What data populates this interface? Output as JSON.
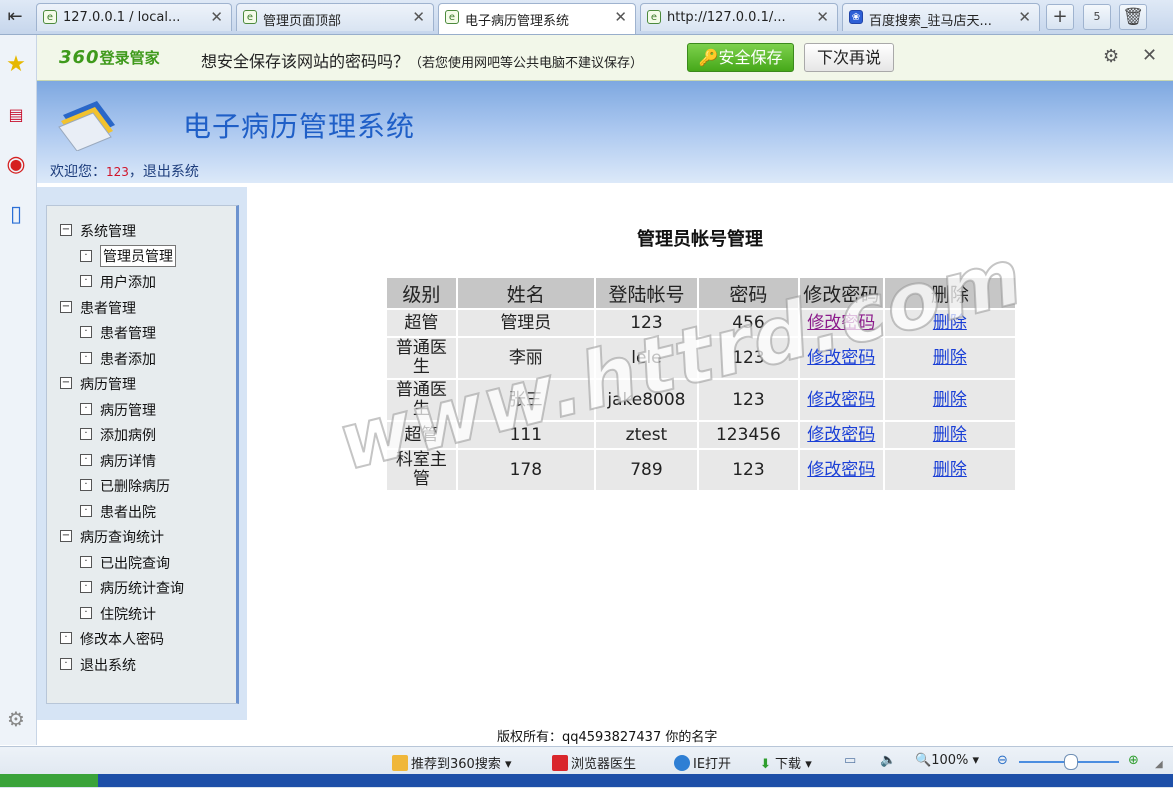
{
  "browser": {
    "tabs": [
      {
        "label": "127.0.0.1 / local...",
        "icon": "page-icon"
      },
      {
        "label": "管理页面顶部",
        "icon": "page-icon"
      },
      {
        "label": "电子病历管理系统",
        "icon": "page-icon",
        "active": true
      },
      {
        "label": "http://127.0.0.1/...",
        "icon": "page-icon"
      },
      {
        "label": "百度搜索_驻马店天...",
        "icon": "baidu-paw-icon"
      }
    ],
    "tab_count": "5"
  },
  "password_bar": {
    "brand_prefix": "360",
    "brand_suffix": "登录管家",
    "question": "想安全保存该网站的密码吗？",
    "note": "（若您使用网吧等公共电脑不建议保存）",
    "save_label": "安全保存",
    "later_label": "下次再说"
  },
  "header": {
    "title": "电子病历管理系统",
    "welcome_prefix": "欢迎您：",
    "user_id": "123",
    "logout_label": "，退出系统"
  },
  "sidebar": {
    "items": [
      {
        "label": "系统管理",
        "level": 0,
        "expanded": true
      },
      {
        "label": "管理员管理",
        "level": 1,
        "selected": true
      },
      {
        "label": "用户添加",
        "level": 1
      },
      {
        "label": "患者管理",
        "level": 0,
        "expanded": true
      },
      {
        "label": "患者管理",
        "level": 1
      },
      {
        "label": "患者添加",
        "level": 1
      },
      {
        "label": "病历管理",
        "level": 0,
        "expanded": true
      },
      {
        "label": "病历管理",
        "level": 1
      },
      {
        "label": "添加病例",
        "level": 1
      },
      {
        "label": "病历详情",
        "level": 1
      },
      {
        "label": "已删除病历",
        "level": 1
      },
      {
        "label": "患者出院",
        "level": 1
      },
      {
        "label": "病历查询统计",
        "level": 0,
        "expanded": true
      },
      {
        "label": "已出院查询",
        "level": 1
      },
      {
        "label": "病历统计查询",
        "level": 1
      },
      {
        "label": "住院统计",
        "level": 1
      },
      {
        "label": "修改本人密码",
        "level": 0
      },
      {
        "label": "退出系统",
        "level": 0
      }
    ]
  },
  "main": {
    "title": "管理员帐号管理",
    "table": {
      "headers": [
        "级别",
        "姓名",
        "登陆帐号",
        "密码",
        "修改密码",
        "删除"
      ],
      "rows": [
        {
          "level": "超管",
          "name": "管理员",
          "account": "123",
          "password": "456",
          "edit": "修改密码",
          "delete": "删除",
          "edit_visited": true
        },
        {
          "level": "普通医生",
          "name": "李丽",
          "account": "lele",
          "password": "123",
          "edit": "修改密码",
          "delete": "删除"
        },
        {
          "level": "普通医生",
          "name": "张三",
          "account": "jake8008",
          "password": "123",
          "edit": "修改密码",
          "delete": "删除"
        },
        {
          "level": "超管",
          "name": "111",
          "account": "ztest",
          "password": "123456",
          "edit": "修改密码",
          "delete": "删除"
        },
        {
          "level": "科室主管",
          "name": "178",
          "account": "789",
          "password": "123",
          "edit": "修改密码",
          "delete": "删除"
        }
      ]
    },
    "copyright": "版权所有：qq4593827437  你的名字"
  },
  "statusbar": {
    "recommend": "推荐到360搜索",
    "doctor": "浏览器医生",
    "ie_open": "IE打开",
    "download": "下载",
    "zoom": "100%"
  },
  "watermark": "www.httrd.com",
  "colors": {
    "accent_green": "#46a819",
    "title_blue": "#1f5fc7",
    "link_blue": "#1a3fd6",
    "header_gray": "#c6c6c6"
  }
}
